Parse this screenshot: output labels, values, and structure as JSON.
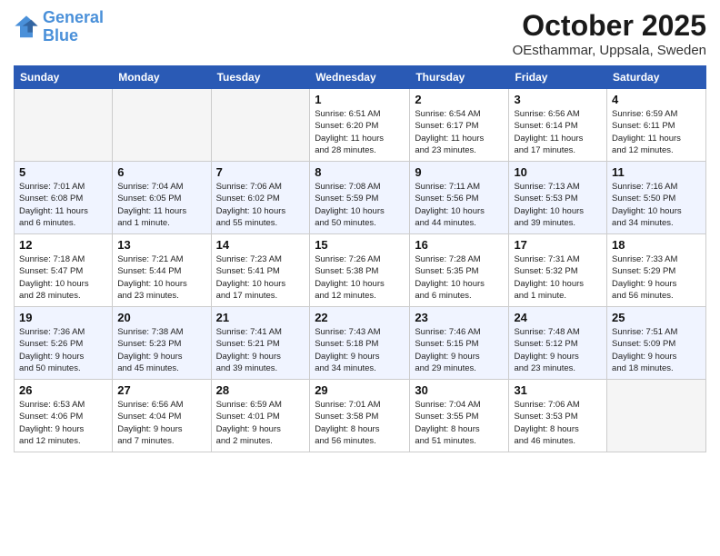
{
  "header": {
    "logo_line1": "General",
    "logo_line2": "Blue",
    "month": "October 2025",
    "location": "OEsthammar, Uppsala, Sweden"
  },
  "weekdays": [
    "Sunday",
    "Monday",
    "Tuesday",
    "Wednesday",
    "Thursday",
    "Friday",
    "Saturday"
  ],
  "weeks": [
    [
      {
        "day": "",
        "info": ""
      },
      {
        "day": "",
        "info": ""
      },
      {
        "day": "",
        "info": ""
      },
      {
        "day": "1",
        "info": "Sunrise: 6:51 AM\nSunset: 6:20 PM\nDaylight: 11 hours\nand 28 minutes."
      },
      {
        "day": "2",
        "info": "Sunrise: 6:54 AM\nSunset: 6:17 PM\nDaylight: 11 hours\nand 23 minutes."
      },
      {
        "day": "3",
        "info": "Sunrise: 6:56 AM\nSunset: 6:14 PM\nDaylight: 11 hours\nand 17 minutes."
      },
      {
        "day": "4",
        "info": "Sunrise: 6:59 AM\nSunset: 6:11 PM\nDaylight: 11 hours\nand 12 minutes."
      }
    ],
    [
      {
        "day": "5",
        "info": "Sunrise: 7:01 AM\nSunset: 6:08 PM\nDaylight: 11 hours\nand 6 minutes."
      },
      {
        "day": "6",
        "info": "Sunrise: 7:04 AM\nSunset: 6:05 PM\nDaylight: 11 hours\nand 1 minute."
      },
      {
        "day": "7",
        "info": "Sunrise: 7:06 AM\nSunset: 6:02 PM\nDaylight: 10 hours\nand 55 minutes."
      },
      {
        "day": "8",
        "info": "Sunrise: 7:08 AM\nSunset: 5:59 PM\nDaylight: 10 hours\nand 50 minutes."
      },
      {
        "day": "9",
        "info": "Sunrise: 7:11 AM\nSunset: 5:56 PM\nDaylight: 10 hours\nand 44 minutes."
      },
      {
        "day": "10",
        "info": "Sunrise: 7:13 AM\nSunset: 5:53 PM\nDaylight: 10 hours\nand 39 minutes."
      },
      {
        "day": "11",
        "info": "Sunrise: 7:16 AM\nSunset: 5:50 PM\nDaylight: 10 hours\nand 34 minutes."
      }
    ],
    [
      {
        "day": "12",
        "info": "Sunrise: 7:18 AM\nSunset: 5:47 PM\nDaylight: 10 hours\nand 28 minutes."
      },
      {
        "day": "13",
        "info": "Sunrise: 7:21 AM\nSunset: 5:44 PM\nDaylight: 10 hours\nand 23 minutes."
      },
      {
        "day": "14",
        "info": "Sunrise: 7:23 AM\nSunset: 5:41 PM\nDaylight: 10 hours\nand 17 minutes."
      },
      {
        "day": "15",
        "info": "Sunrise: 7:26 AM\nSunset: 5:38 PM\nDaylight: 10 hours\nand 12 minutes."
      },
      {
        "day": "16",
        "info": "Sunrise: 7:28 AM\nSunset: 5:35 PM\nDaylight: 10 hours\nand 6 minutes."
      },
      {
        "day": "17",
        "info": "Sunrise: 7:31 AM\nSunset: 5:32 PM\nDaylight: 10 hours\nand 1 minute."
      },
      {
        "day": "18",
        "info": "Sunrise: 7:33 AM\nSunset: 5:29 PM\nDaylight: 9 hours\nand 56 minutes."
      }
    ],
    [
      {
        "day": "19",
        "info": "Sunrise: 7:36 AM\nSunset: 5:26 PM\nDaylight: 9 hours\nand 50 minutes."
      },
      {
        "day": "20",
        "info": "Sunrise: 7:38 AM\nSunset: 5:23 PM\nDaylight: 9 hours\nand 45 minutes."
      },
      {
        "day": "21",
        "info": "Sunrise: 7:41 AM\nSunset: 5:21 PM\nDaylight: 9 hours\nand 39 minutes."
      },
      {
        "day": "22",
        "info": "Sunrise: 7:43 AM\nSunset: 5:18 PM\nDaylight: 9 hours\nand 34 minutes."
      },
      {
        "day": "23",
        "info": "Sunrise: 7:46 AM\nSunset: 5:15 PM\nDaylight: 9 hours\nand 29 minutes."
      },
      {
        "day": "24",
        "info": "Sunrise: 7:48 AM\nSunset: 5:12 PM\nDaylight: 9 hours\nand 23 minutes."
      },
      {
        "day": "25",
        "info": "Sunrise: 7:51 AM\nSunset: 5:09 PM\nDaylight: 9 hours\nand 18 minutes."
      }
    ],
    [
      {
        "day": "26",
        "info": "Sunrise: 6:53 AM\nSunset: 4:06 PM\nDaylight: 9 hours\nand 12 minutes."
      },
      {
        "day": "27",
        "info": "Sunrise: 6:56 AM\nSunset: 4:04 PM\nDaylight: 9 hours\nand 7 minutes."
      },
      {
        "day": "28",
        "info": "Sunrise: 6:59 AM\nSunset: 4:01 PM\nDaylight: 9 hours\nand 2 minutes."
      },
      {
        "day": "29",
        "info": "Sunrise: 7:01 AM\nSunset: 3:58 PM\nDaylight: 8 hours\nand 56 minutes."
      },
      {
        "day": "30",
        "info": "Sunrise: 7:04 AM\nSunset: 3:55 PM\nDaylight: 8 hours\nand 51 minutes."
      },
      {
        "day": "31",
        "info": "Sunrise: 7:06 AM\nSunset: 3:53 PM\nDaylight: 8 hours\nand 46 minutes."
      },
      {
        "day": "",
        "info": ""
      }
    ]
  ]
}
